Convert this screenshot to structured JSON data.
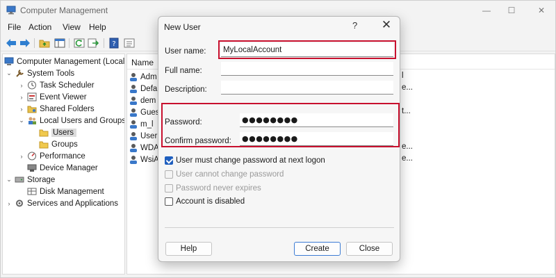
{
  "window": {
    "title": "Computer Management",
    "controls": {
      "minimize": "—",
      "maximize": "☐",
      "close": "✕"
    }
  },
  "menu": [
    "File",
    "Action",
    "View",
    "Help"
  ],
  "toolbar": {
    "icons": [
      "back-arrow-icon",
      "forward-arrow-icon",
      "up-folder-icon",
      "show-hide-tree-icon",
      "refresh-icon",
      "export-list-icon",
      "help-icon",
      "properties-icon"
    ]
  },
  "tree": {
    "items": [
      {
        "label": "Computer Management (Local",
        "level": 0,
        "chevron": "",
        "icon": "computer-icon"
      },
      {
        "label": "System Tools",
        "level": 1,
        "chevron": "⌄",
        "icon": "tools-icon"
      },
      {
        "label": "Task Scheduler",
        "level": 2,
        "chevron": "›",
        "icon": "clock-icon"
      },
      {
        "label": "Event Viewer",
        "level": 2,
        "chevron": "›",
        "icon": "event-viewer-icon"
      },
      {
        "label": "Shared Folders",
        "level": 2,
        "chevron": "›",
        "icon": "shared-folders-icon"
      },
      {
        "label": "Local Users and Groups",
        "level": 2,
        "chevron": "⌄",
        "icon": "users-group-icon"
      },
      {
        "label": "Users",
        "level": 3,
        "chevron": "",
        "icon": "folder-icon",
        "selected": true
      },
      {
        "label": "Groups",
        "level": 3,
        "chevron": "",
        "icon": "folder-icon"
      },
      {
        "label": "Performance",
        "level": 2,
        "chevron": "›",
        "icon": "performance-icon"
      },
      {
        "label": "Device Manager",
        "level": 2,
        "chevron": "",
        "icon": "device-manager-icon"
      },
      {
        "label": "Storage",
        "level": 1,
        "chevron": "⌄",
        "icon": "storage-icon"
      },
      {
        "label": "Disk Management",
        "level": 2,
        "chevron": "",
        "icon": "disk-icon"
      },
      {
        "label": "Services and Applications",
        "level": 1,
        "chevron": "›",
        "icon": "services-icon"
      }
    ]
  },
  "list": {
    "column_name": "Name",
    "rows": [
      {
        "name": "Adm",
        "tail": "l"
      },
      {
        "name": "Defa",
        "tail": "e..."
      },
      {
        "name": "dem",
        "tail": ""
      },
      {
        "name": "Gues",
        "tail": "t..."
      },
      {
        "name": "m_l",
        "tail": ""
      },
      {
        "name": "Userl",
        "tail": ""
      },
      {
        "name": "WDA",
        "tail": "e..."
      },
      {
        "name": "WsiA",
        "tail": "e..."
      }
    ]
  },
  "dialog": {
    "title": "New User",
    "help": "?",
    "close": "✕",
    "fields": {
      "username": {
        "label": "User name:",
        "value": "MyLocalAccount"
      },
      "fullname": {
        "label": "Full name:",
        "value": ""
      },
      "description": {
        "label": "Description:",
        "value": ""
      },
      "password": {
        "label": "Password:",
        "value": "●●●●●●●●"
      },
      "confirm": {
        "label": "Confirm password:",
        "value": "●●●●●●●●"
      }
    },
    "checkboxes": [
      {
        "label": "User must change password at next logon",
        "checked": true,
        "disabled": false
      },
      {
        "label": "User cannot change password",
        "checked": false,
        "disabled": true
      },
      {
        "label": "Password never expires",
        "checked": false,
        "disabled": true
      },
      {
        "label": "Account is disabled",
        "checked": false,
        "disabled": false
      }
    ],
    "buttons": {
      "help": "Help",
      "create": "Create",
      "close": "Close"
    }
  },
  "colors": {
    "highlight": "#c8102e",
    "accent": "#1f5fbf",
    "selected_row": "#dcdcdc"
  }
}
